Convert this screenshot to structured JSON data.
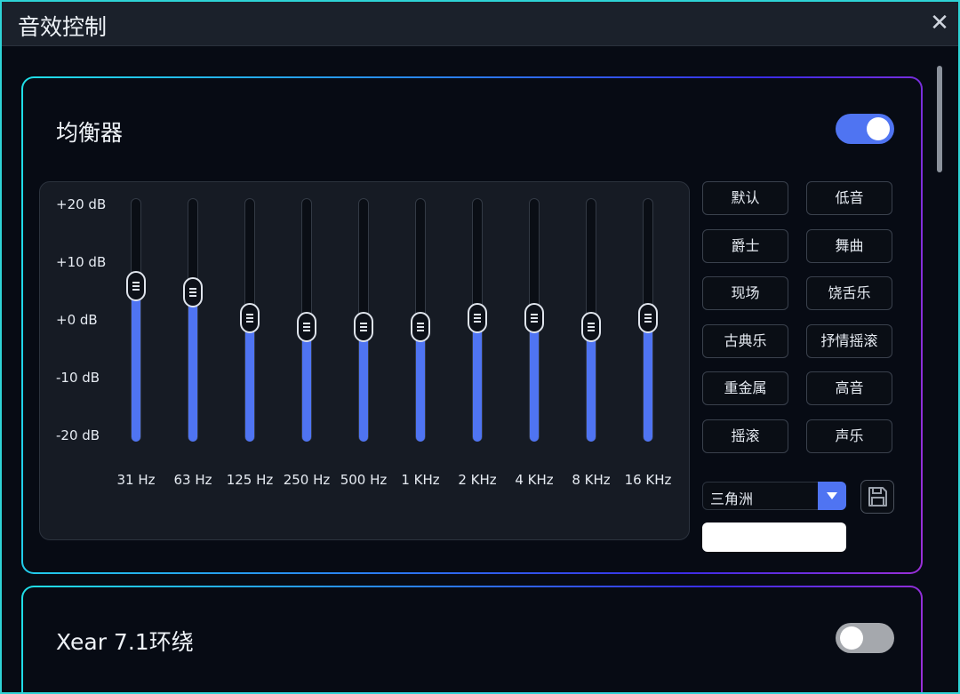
{
  "window": {
    "title": "音效控制",
    "close_icon": "close-icon"
  },
  "equalizer": {
    "title": "均衡器",
    "enabled": true,
    "db_labels": [
      "+20 dB",
      "+10 dB",
      "+0 dB",
      "-10 dB",
      "-20 dB"
    ],
    "bands": [
      {
        "label": "31 Hz",
        "gain_db": 5.5
      },
      {
        "label": "63 Hz",
        "gain_db": 4.5
      },
      {
        "label": "125 Hz",
        "gain_db": 0
      },
      {
        "label": "250 Hz",
        "gain_db": -1.5
      },
      {
        "label": "500 Hz",
        "gain_db": -1.5
      },
      {
        "label": "1 KHz",
        "gain_db": -1.5
      },
      {
        "label": "2 KHz",
        "gain_db": 0
      },
      {
        "label": "4 KHz",
        "gain_db": 0
      },
      {
        "label": "8 KHz",
        "gain_db": -1.5
      },
      {
        "label": "16 KHz",
        "gain_db": 0
      }
    ],
    "presets": [
      "默认",
      "低音",
      "爵士",
      "舞曲",
      "现场",
      "饶舌乐",
      "古典乐",
      "抒情摇滚",
      "重金属",
      "高音",
      "摇滚",
      "声乐"
    ],
    "selected_profile": "三角洲",
    "profile_name_input": ""
  },
  "xear": {
    "title": "Xear 7.1环绕",
    "enabled": false
  },
  "colors": {
    "accent": "#4f74f2",
    "border_cyan": "#2ed3d6",
    "panel_bg": "#161b24"
  }
}
